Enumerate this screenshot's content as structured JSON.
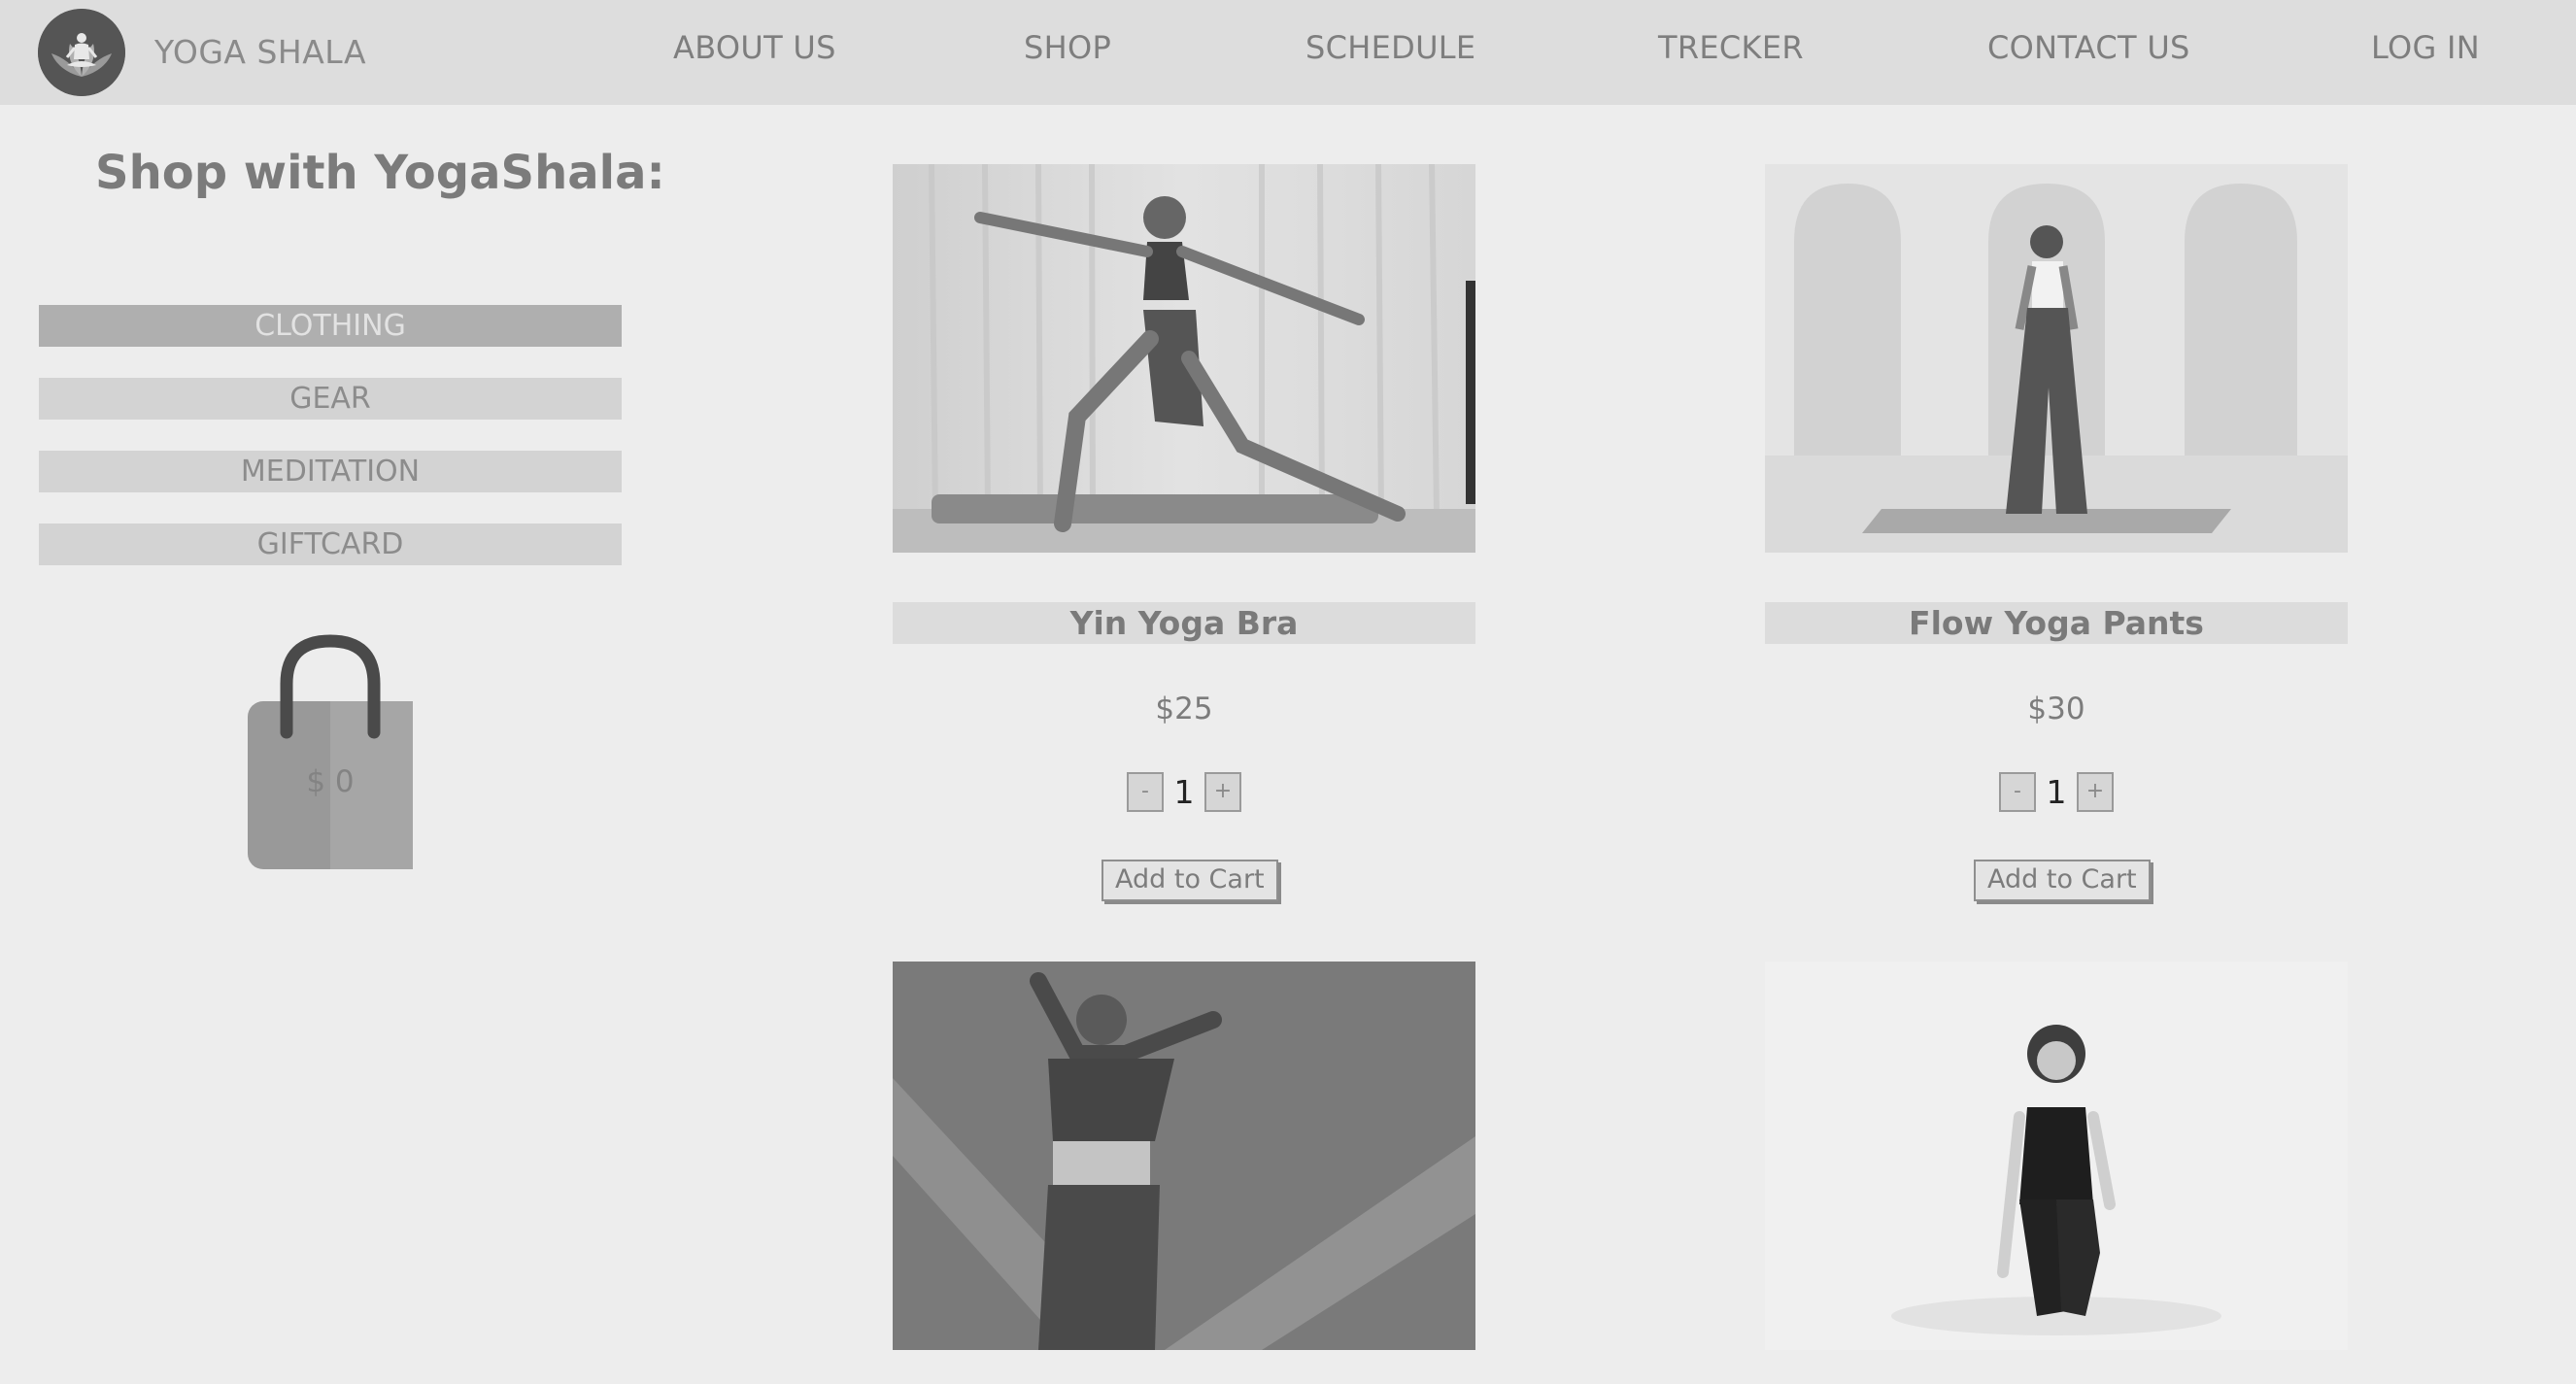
{
  "navbar": {
    "brand": "YOGA SHALA",
    "logo_icon": "lotus-meditation-icon",
    "links": [
      "ABOUT US",
      "SHOP",
      "SCHEDULE",
      "TRECKER",
      "CONTACT US",
      "LOG IN"
    ]
  },
  "sidebar": {
    "title": "Shop with YogaShala:",
    "categories": [
      "CLOTHING",
      "GEAR",
      "MEDITATION",
      "GIFTCARD"
    ],
    "active_category": "CLOTHING",
    "cart": {
      "icon": "shopping-bag-icon",
      "total": "$ 0"
    }
  },
  "products": [
    {
      "name": "Yin Yoga Bra",
      "price": "$25",
      "quantity": "1",
      "decrement": "-",
      "increment": "+",
      "add_label": "Add to Cart"
    },
    {
      "name": "Flow Yoga Pants",
      "price": "$30",
      "quantity": "1",
      "decrement": "-",
      "increment": "+",
      "add_label": "Add to Cart"
    },
    {},
    {}
  ],
  "colors": {
    "page_bg": "#ededed",
    "navbar_bg": "#dddddd",
    "active_category_bg": "#afafaf",
    "category_bg": "#d3d3d3"
  }
}
